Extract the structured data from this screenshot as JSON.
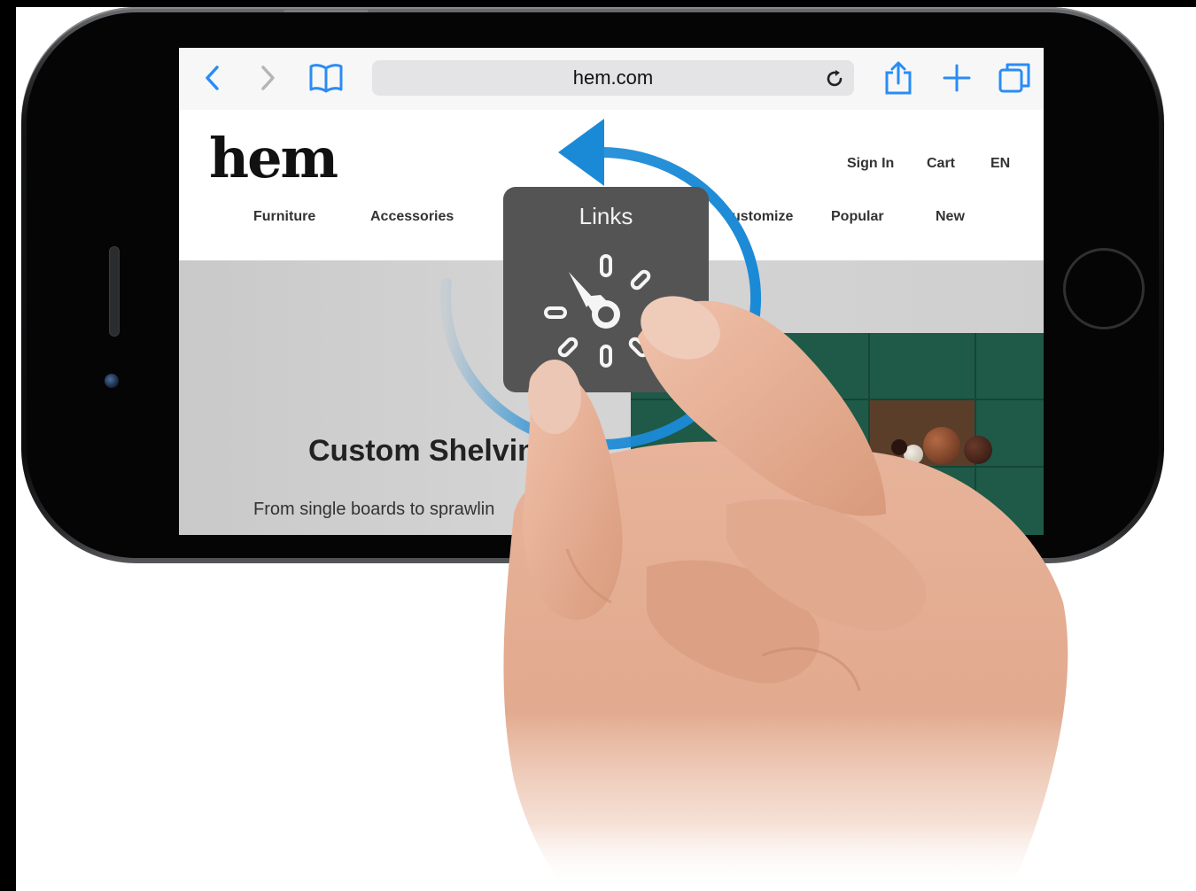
{
  "browser": {
    "url": "hem.com",
    "icons": [
      "back-icon",
      "forward-icon",
      "bookmarks-icon",
      "reload-icon",
      "share-icon",
      "new-tab-icon",
      "tabs-icon"
    ]
  },
  "site": {
    "logo": "hem",
    "utility_links": [
      "Sign In",
      "Cart",
      "EN"
    ],
    "nav": [
      "Furniture",
      "Accessories",
      "ustomize",
      "Popular",
      "New"
    ],
    "hero_title": "Custom Shelvin",
    "hero_subtitle": "From single boards to sprawlin"
  },
  "rotor": {
    "label": "Links"
  },
  "colors": {
    "accent_blue": "#2a8cf5",
    "rotation_arrow": "#1b8ad6",
    "rotor_panel": "#545454",
    "shelf_green": "#1e5a47"
  }
}
